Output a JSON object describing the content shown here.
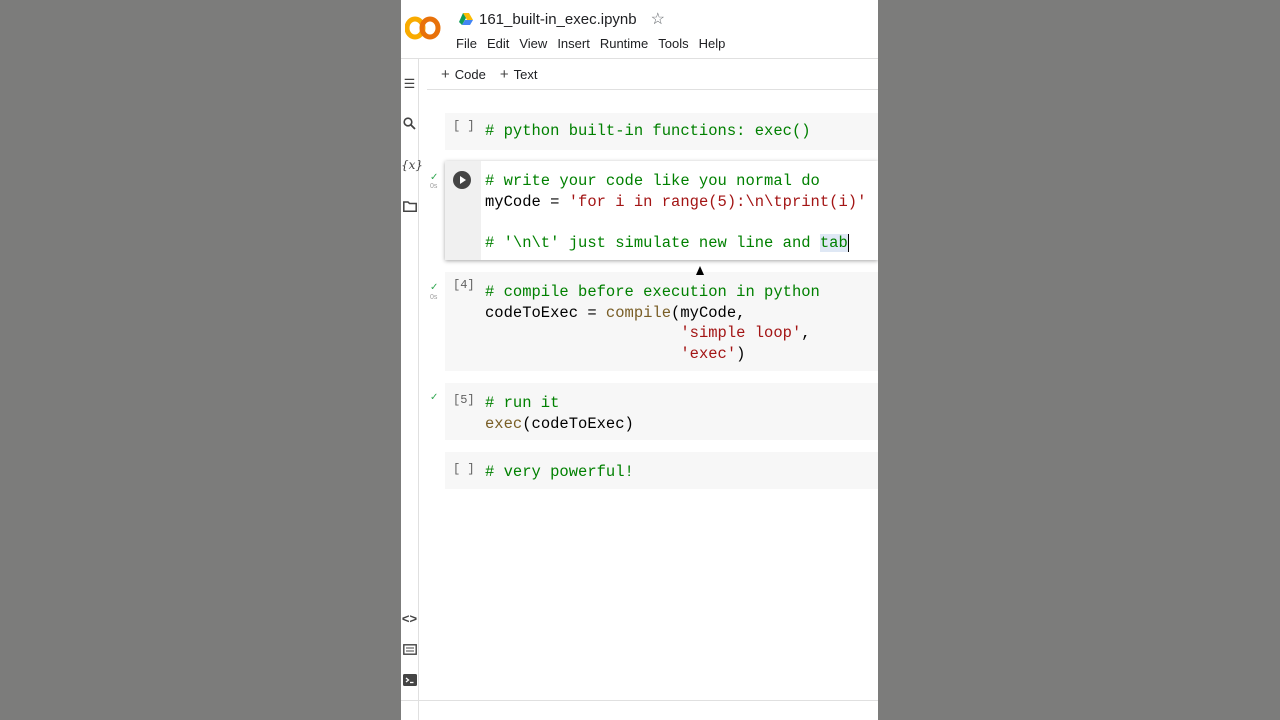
{
  "header": {
    "notebook_title": "161_built-in_exec.ipynb",
    "menu": [
      "File",
      "Edit",
      "View",
      "Insert",
      "Runtime",
      "Tools",
      "Help"
    ]
  },
  "toolbar": {
    "code_label": "Code",
    "text_label": "Text"
  },
  "sidebar": [
    "toc-icon",
    "search-icon",
    "variables-icon",
    "folder-icon",
    "code-snippets-icon",
    "command-palette-icon",
    "terminal-icon"
  ],
  "cells": [
    {
      "prompt": "[ ]",
      "lines": [
        "# python built-in functions: exec()"
      ]
    },
    {
      "prompt": "",
      "executed": "0s",
      "lines": [
        "# write your code like you normal do",
        "myCode = 'for i in range(5):\\n\\tprint(i)'",
        "",
        "# '\\n\\t' just simulate new line and tab"
      ]
    },
    {
      "prompt": "[4]",
      "executed": "0s",
      "lines": [
        "# compile before execution in python",
        "codeToExec = compile(myCode,",
        "                     'simple loop',",
        "                     'exec')"
      ]
    },
    {
      "prompt": "[5]",
      "lines": [
        "# run it",
        "exec(codeToExec)"
      ]
    },
    {
      "prompt": "[ ]",
      "lines": [
        "# very powerful!"
      ]
    }
  ],
  "colors": {
    "comment": "#008000",
    "string": "#a31515",
    "function": "#795e26",
    "check": "#34a853"
  }
}
